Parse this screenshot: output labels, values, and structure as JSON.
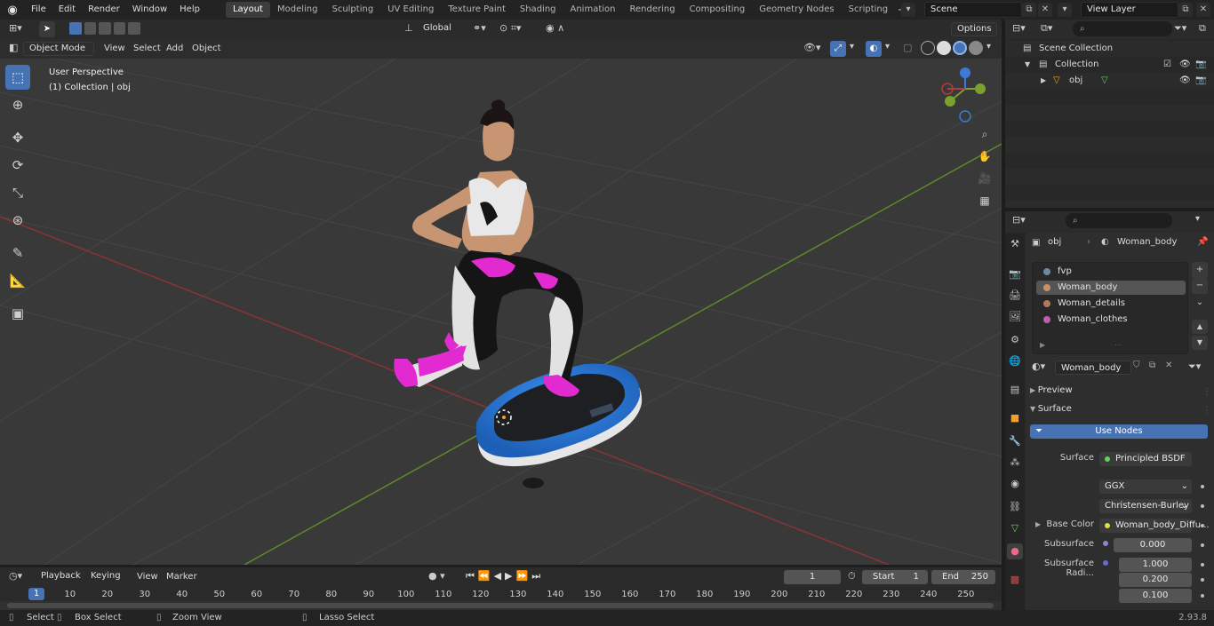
{
  "topbar": {
    "menus": [
      "File",
      "Edit",
      "Render",
      "Window",
      "Help"
    ],
    "workspaces": [
      "Layout",
      "Modeling",
      "Sculpting",
      "UV Editing",
      "Texture Paint",
      "Shading",
      "Animation",
      "Rendering",
      "Compositing",
      "Geometry Nodes",
      "Scripting"
    ],
    "add_label": "+",
    "scene": "Scene",
    "view_layer": "View Layer"
  },
  "viewport": {
    "mode": "Object Mode",
    "menus": [
      "View",
      "Select",
      "Add",
      "Object"
    ],
    "transform_orientation": "Global",
    "options_label": "Options",
    "perspective": "User Perspective",
    "collection_info": "(1) Collection | obj"
  },
  "outliner": {
    "rows": [
      "Scene Collection",
      "Collection",
      "obj"
    ]
  },
  "properties": {
    "object_name": "obj",
    "material_name": "Woman_body",
    "material_slots": [
      "fvp",
      "Woman_body",
      "Woman_details",
      "Woman_clothes"
    ],
    "selected_slot": "Woman_body",
    "datablock": "Woman_body",
    "sections": {
      "preview": "Preview",
      "surface": "Surface"
    },
    "use_nodes": "Use Nodes",
    "surface_label": "Surface",
    "surface_value": "Principled BSDF",
    "distribution": "GGX",
    "subsurface_method": "Christensen-Burley",
    "base_color_label": "Base Color",
    "base_color_value": "Woman_body_Diffu...",
    "subsurface_label": "Subsurface",
    "subsurface_value": "0.000",
    "subsurface_radius_label": "Subsurface Radi...",
    "subsurface_radius": [
      "1.000",
      "0.200",
      "0.100"
    ]
  },
  "timeline": {
    "menus": [
      "Playback",
      "Keying",
      "View",
      "Marker"
    ],
    "current_frame": "1",
    "start_label": "Start",
    "start_value": "1",
    "end_label": "End",
    "end_value": "250",
    "ticks": [
      "1",
      "10",
      "20",
      "30",
      "40",
      "50",
      "60",
      "70",
      "80",
      "90",
      "100",
      "110",
      "120",
      "130",
      "140",
      "150",
      "160",
      "170",
      "180",
      "190",
      "200",
      "210",
      "220",
      "230",
      "240",
      "250"
    ]
  },
  "statusbar": {
    "select": "Select",
    "box_select": "Box Select",
    "zoom_view": "Zoom View",
    "lasso_select": "Lasso Select",
    "version": "2.93.8"
  },
  "colors": {
    "accent": "#4772b3",
    "viewport_bg": "#393939",
    "grid_x_axis": "#b23d3d",
    "grid_y_axis": "#6a9a2a",
    "platform_blue": "#2d78d6",
    "pink_accent": "#e12bd1"
  }
}
